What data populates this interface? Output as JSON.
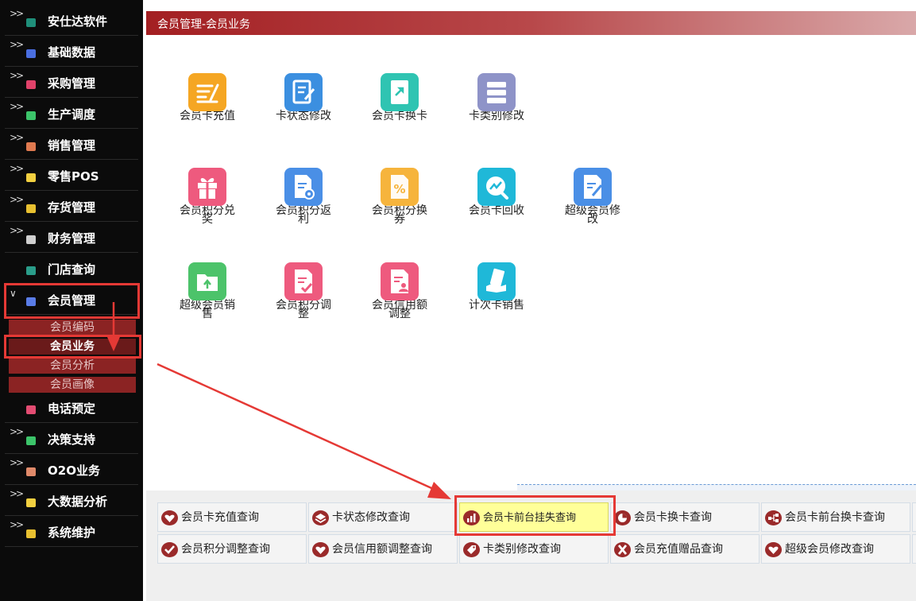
{
  "sidebar": {
    "items": [
      {
        "label": "安仕达软件",
        "icon": "teal-cube-icon",
        "color": "#1f8f7a"
      },
      {
        "label": "基础数据",
        "icon": "blue-cube-icon",
        "color": "#4a6ee0"
      },
      {
        "label": "采购管理",
        "icon": "pink-cube-icon",
        "color": "#e0426a"
      },
      {
        "label": "生产调度",
        "icon": "green-cube-icon",
        "color": "#3cc46a"
      },
      {
        "label": "销售管理",
        "icon": "orange-cube-icon",
        "color": "#e07a50"
      },
      {
        "label": "零售POS",
        "icon": "yellow-cube-icon",
        "color": "#f2d040"
      },
      {
        "label": "存货管理",
        "icon": "yellow-cube-icon",
        "color": "#e8c030"
      },
      {
        "label": "财务管理",
        "icon": "gray-cube-icon",
        "color": "#cfcfcf"
      },
      {
        "label": "门店查询",
        "icon": "teal-cube-icon",
        "color": "#2a9d8a"
      },
      {
        "label": "会员管理",
        "icon": "blue-cube-icon",
        "color": "#5a7de8"
      },
      {
        "label": "电话预定",
        "icon": "pink-cube-icon",
        "color": "#e34c72"
      },
      {
        "label": "决策支持",
        "icon": "green-cube-icon",
        "color": "#3cc46a"
      },
      {
        "label": "O2O业务",
        "icon": "orange-cube-icon",
        "color": "#e08a6a"
      },
      {
        "label": "大数据分析",
        "icon": "yellow-cube-icon",
        "color": "#f2d040"
      },
      {
        "label": "系统维护",
        "icon": "yellow-cube-icon",
        "color": "#e8c030"
      }
    ],
    "sub_items": [
      {
        "label": "会员编码"
      },
      {
        "label": "会员业务"
      },
      {
        "label": "会员分析"
      },
      {
        "label": "会员画像"
      }
    ]
  },
  "header": {
    "title": "会员管理-会员业务"
  },
  "tiles": [
    {
      "label": "会员卡充值",
      "icon": "recharge-icon",
      "color": "#f5a623"
    },
    {
      "label": "卡状态修改",
      "icon": "edit-document-icon",
      "color": "#3b8fe0"
    },
    {
      "label": "会员卡换卡",
      "icon": "card-swap-icon",
      "color": "#2fc4b2"
    },
    {
      "label": "卡类别修改",
      "icon": "server-list-icon",
      "color": "#8e93c8"
    },
    {
      "label": "会员积分兑奖",
      "icon": "gift-icon",
      "color": "#ee5a7e"
    },
    {
      "label": "会员积分返利",
      "icon": "document-gear-icon",
      "color": "#4a8fe6"
    },
    {
      "label": "会员积分换券",
      "icon": "coupon-percent-icon",
      "color": "#f6b43c"
    },
    {
      "label": "会员卡回收",
      "icon": "trend-search-icon",
      "color": "#1fb8d8"
    },
    {
      "label": "超级会员修改",
      "icon": "edit-document-icon",
      "color": "#4a8fe6"
    },
    {
      "label": "超级会员销售",
      "icon": "folder-upload-icon",
      "color": "#4cc36a"
    },
    {
      "label": "会员积分调整",
      "icon": "document-check-icon",
      "color": "#ee5a7e"
    },
    {
      "label": "会员信用额调整",
      "icon": "user-document-icon",
      "color": "#ee5a7e"
    },
    {
      "label": "计次卡销售",
      "icon": "cash-hand-icon",
      "color": "#1fb8d8"
    }
  ],
  "queries": [
    {
      "label": "会员卡充值查询",
      "icon": "heart-hands-icon"
    },
    {
      "label": "卡状态修改查询",
      "icon": "layers-icon"
    },
    {
      "label": "会员卡前台挂失查询",
      "icon": "bar-chart-icon"
    },
    {
      "label": "会员卡换卡查询",
      "icon": "pie-chart-icon"
    },
    {
      "label": "会员卡前台换卡查询",
      "icon": "flow-icon"
    },
    {
      "label": "会员积分调整查询",
      "icon": "checkmark-icon"
    },
    {
      "label": "会员信用额调整查询",
      "icon": "heart-hands-icon"
    },
    {
      "label": "卡类别修改查询",
      "icon": "tag-icon"
    },
    {
      "label": "会员充值赠品查询",
      "icon": "x-icon"
    },
    {
      "label": "超级会员修改查询",
      "icon": "heart-hands-icon"
    }
  ],
  "colors": {
    "accent": "#a31f22",
    "highlight": "#e53935",
    "selected_query": "#ffff99"
  }
}
